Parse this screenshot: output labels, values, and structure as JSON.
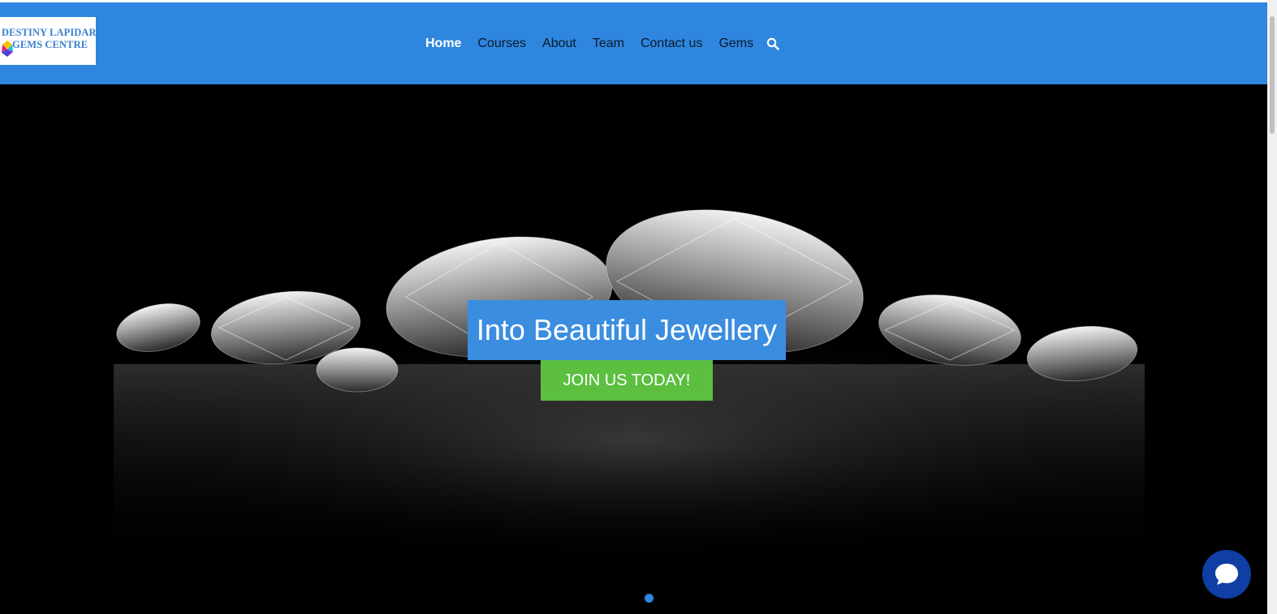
{
  "header": {
    "logo": {
      "line1": "DESTINY LAPIDARY",
      "line2": "GEMS CENTRE"
    },
    "nav": [
      {
        "label": "Home",
        "active": true
      },
      {
        "label": "Courses",
        "active": false
      },
      {
        "label": "About",
        "active": false
      },
      {
        "label": "Team",
        "active": false
      },
      {
        "label": "Contact us",
        "active": false
      },
      {
        "label": "Gems",
        "active": false
      }
    ],
    "search_icon": "search-icon",
    "background_color": "#2e86de"
  },
  "hero": {
    "headline": "Into Beautiful Jewellery",
    "cta_label": "JOIN US TODAY!",
    "headline_bg": "#3b8de0",
    "cta_bg": "#5cbf3f",
    "slider_dots": 1,
    "active_slide": 1
  },
  "chat_widget": {
    "icon": "chat-bubble-icon",
    "color": "#0f3fa5"
  }
}
